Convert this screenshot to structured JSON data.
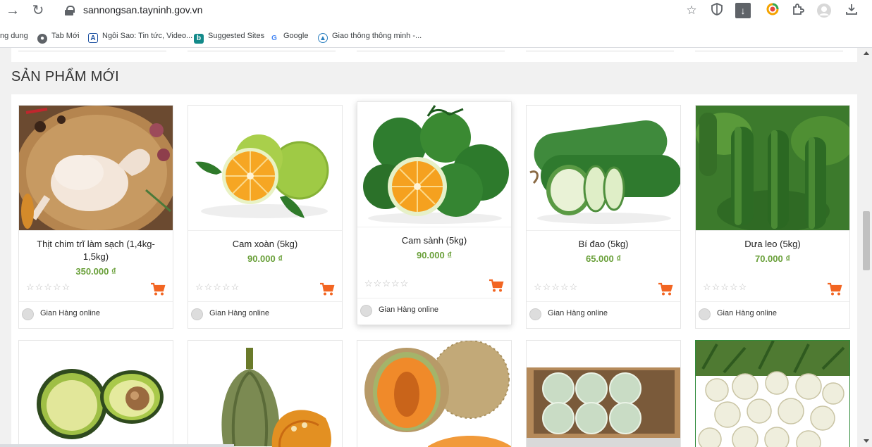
{
  "browser": {
    "url": "sannongsan.tayninh.gov.vn",
    "bookmarks": [
      {
        "label": "ng dung"
      },
      {
        "label": "Tab Mới"
      },
      {
        "label": "Ngôi Sao: Tin tức, Video..."
      },
      {
        "label": "Suggested Sites"
      },
      {
        "label": "Google"
      },
      {
        "label": "Giao thông thông minh -..."
      }
    ]
  },
  "section": {
    "title": "SẢN PHẨM MỚI"
  },
  "products": [
    {
      "name": "Thịt chim trĩ làm sạch (1,4kg-1,5kg)",
      "price": "350.000 ₫",
      "shop": "Gian Hàng online"
    },
    {
      "name": "Cam xoàn (5kg)",
      "price": "90.000 ₫",
      "shop": "Gian Hàng online"
    },
    {
      "name": "Cam sành (5kg)",
      "price": "90.000 ₫",
      "shop": "Gian Hàng online"
    },
    {
      "name": "Bí đao (5kg)",
      "price": "65.000 ₫",
      "shop": "Gian Hàng online"
    },
    {
      "name": "Dưa leo (5kg)",
      "price": "70.000 ₫",
      "shop": "Gian Hàng online"
    }
  ],
  "second_row": [
    {
      "image": "avocado"
    },
    {
      "image": "pumpkin"
    },
    {
      "image": "cantaloupe"
    },
    {
      "image": "melon-box"
    },
    {
      "image": "turnips"
    }
  ],
  "colors": {
    "price": "#6aa03a",
    "cart": "#f26522",
    "accent": "#f26522"
  }
}
